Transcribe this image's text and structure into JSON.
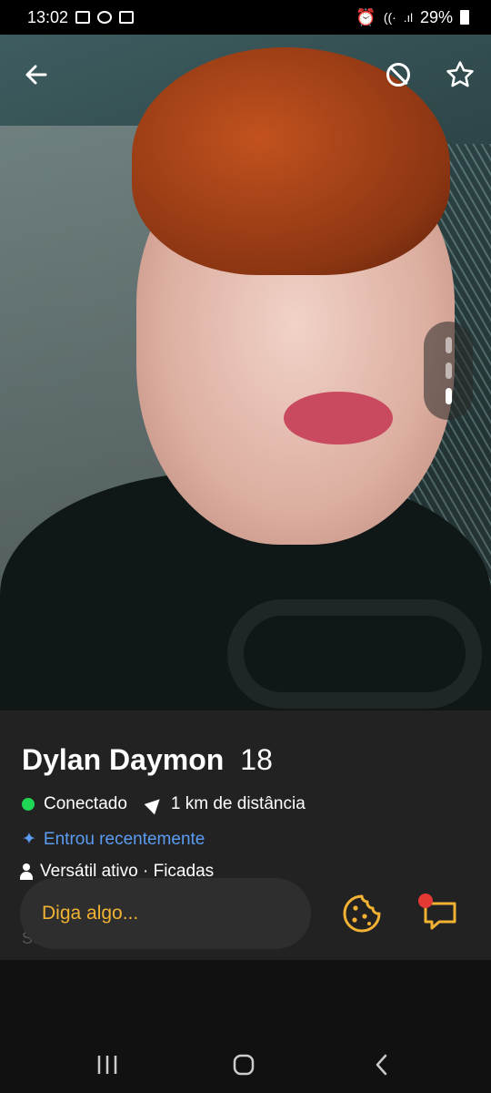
{
  "status_bar": {
    "time": "13:02",
    "battery": "29%"
  },
  "profile": {
    "name": "Dylan Daymon",
    "age": "18",
    "status": "Conectado",
    "distance": "1 km de distância",
    "recent": "Entrou recentemente",
    "details": "Versátil ativo · Ficadas",
    "faded_text": "So"
  },
  "message_input": {
    "placeholder": "Diga algo..."
  },
  "colors": {
    "accent": "#f2b233",
    "online": "#1fd655",
    "link": "#5b9cf2",
    "notification": "#e53935"
  },
  "photo": {
    "count": 3,
    "active_index": 2
  }
}
